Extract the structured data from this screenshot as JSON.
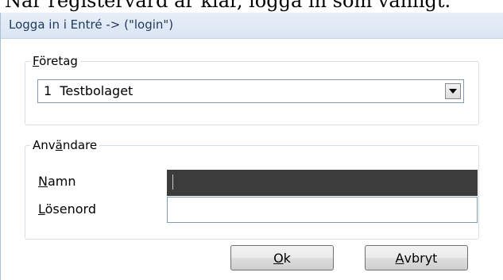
{
  "caption": "När registervård är klar, logga in som vanligt.",
  "window": {
    "title": "Logga in i Entré   -> (\"login\")"
  },
  "company_group": {
    "legend_mnemonic": "F",
    "legend_rest": "öretag",
    "selected_value": "1  Testbolaget",
    "dropdown_icon": "chevron-down-icon"
  },
  "user_group": {
    "legend_prefix": "Anv",
    "legend_mnemonic": "ä",
    "legend_rest": "ndare",
    "name_mnemonic": "N",
    "name_rest": "amn",
    "name_value": "",
    "password_mnemonic": "L",
    "password_rest": "ösenord",
    "password_value": ""
  },
  "buttons": {
    "ok_mnemonic": "O",
    "ok_rest": "k",
    "cancel_mnemonic": "A",
    "cancel_rest": "vbryt"
  }
}
